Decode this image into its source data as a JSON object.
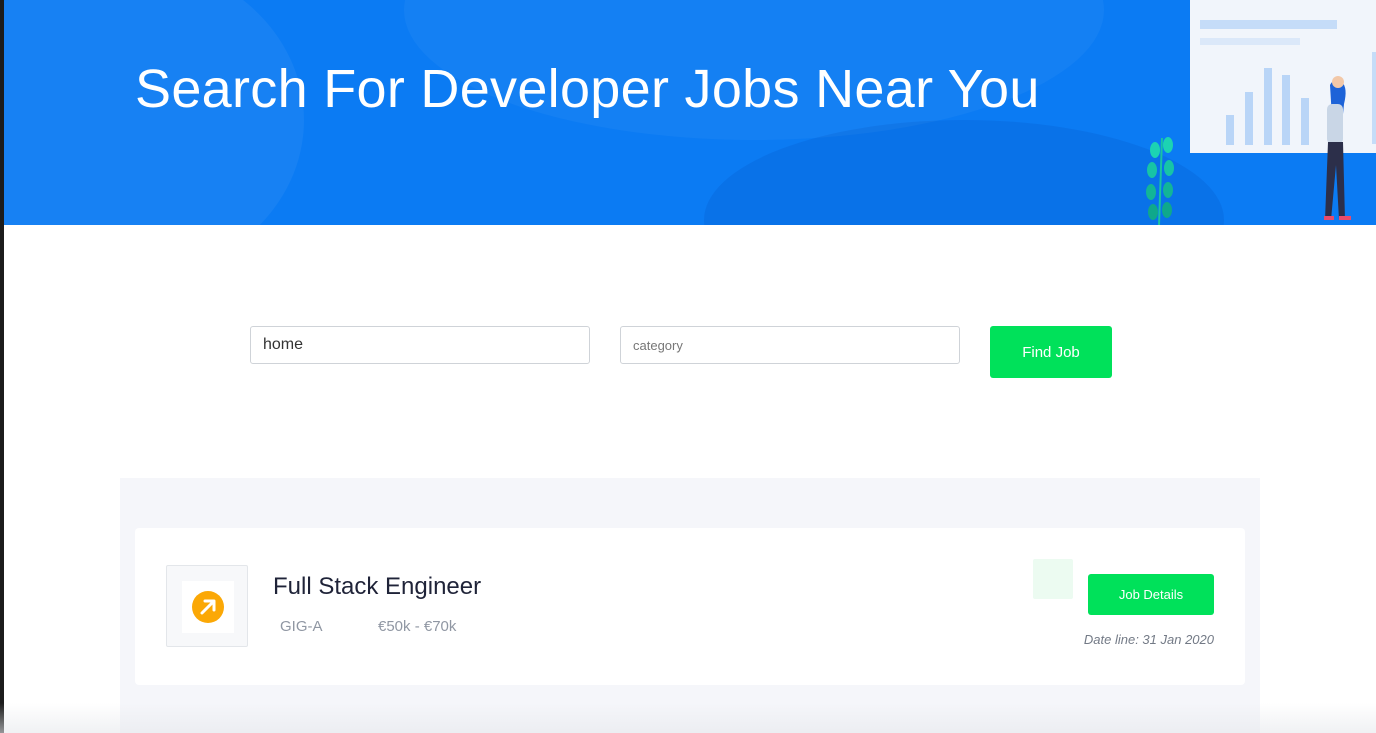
{
  "hero": {
    "title": "Search For Developer Jobs Near You",
    "background_color": "#0b7bf3",
    "illustration": "analytics-illustration"
  },
  "search": {
    "keyword_value": "home",
    "keyword_placeholder": "",
    "category_value": "",
    "category_placeholder": "category",
    "submit_label": "Find Job",
    "accent_color": "#00e15a"
  },
  "results": {
    "jobs": [
      {
        "title": "Full Stack Engineer",
        "company": "GIG-A",
        "salary": "€50k - €70k",
        "details_label": "Job Details",
        "date_line": "Date line: 31 Jan 2020",
        "logo_icon": "arrow-up-right-icon",
        "logo_color": "#fba806"
      }
    ]
  }
}
